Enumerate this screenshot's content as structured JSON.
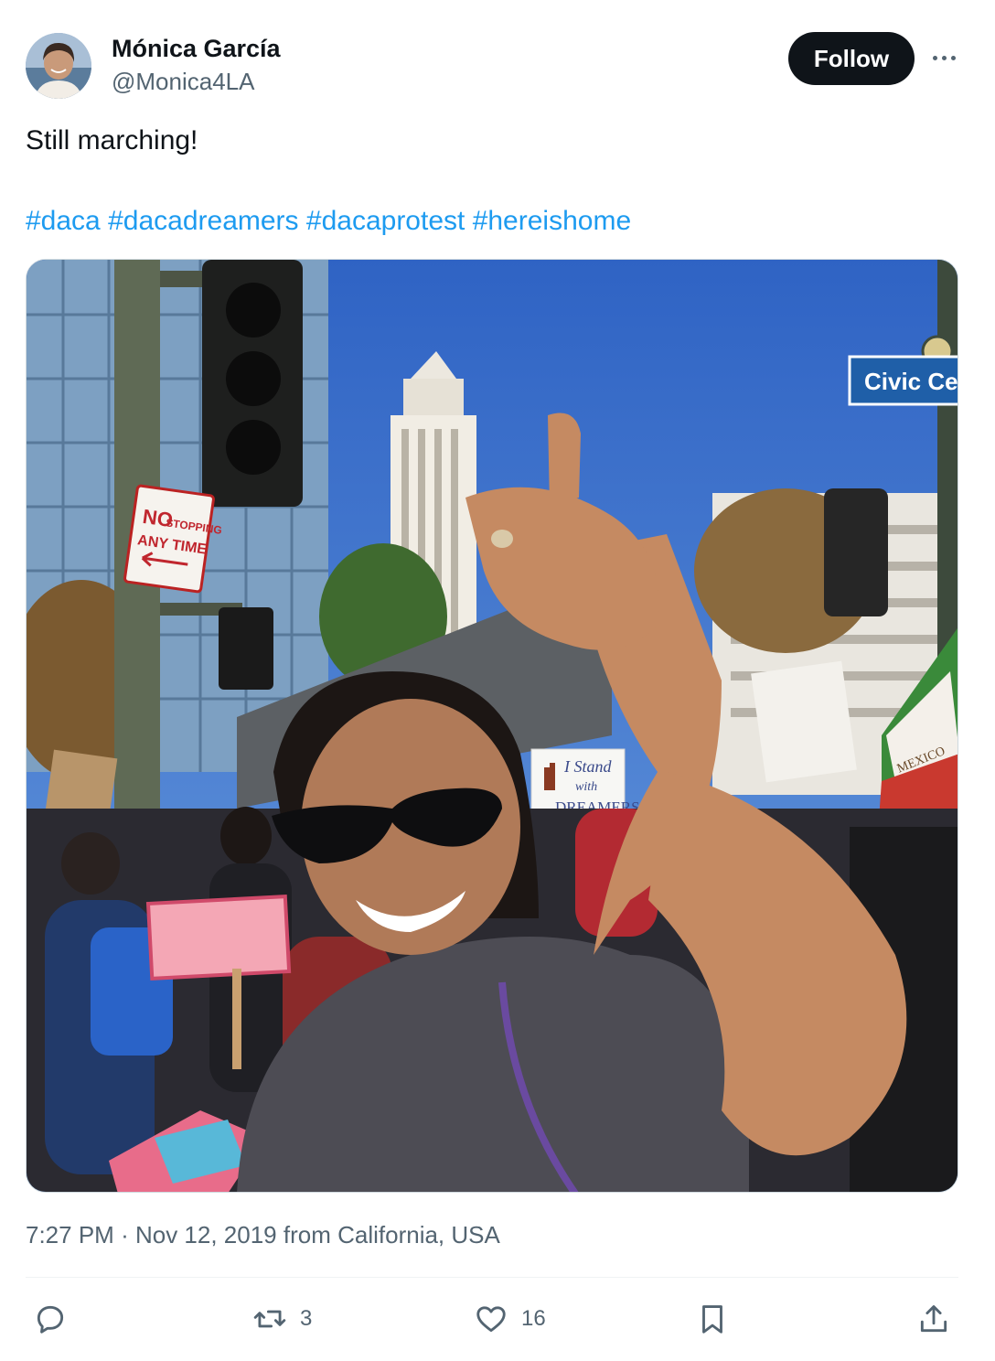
{
  "author": {
    "display_name": "Mónica García",
    "handle": "@Monica4LA"
  },
  "follow_label": "Follow",
  "tweet": {
    "text": "Still marching!",
    "hashtags": [
      "#daca",
      "#dacadreamers",
      "#dacaprotest",
      "#hereishome"
    ]
  },
  "photo": {
    "street_sign": "Civic Ce",
    "no_stopping_sign": [
      "NO",
      "STOPPING",
      "ANY TIME"
    ],
    "protest_sign": [
      "I Stand",
      "with",
      "DREAMERS"
    ],
    "flag_text": "MEXICO"
  },
  "meta": {
    "time": "7:27 PM",
    "separator": "·",
    "date": "Nov 12, 2019",
    "location": "from California, USA"
  },
  "actions": {
    "reply": {
      "icon": "reply-icon",
      "count": ""
    },
    "retweet": {
      "icon": "retweet-icon",
      "count": "3"
    },
    "like": {
      "icon": "heart-icon",
      "count": "16"
    },
    "bookmark": {
      "icon": "bookmark-icon",
      "count": ""
    },
    "share": {
      "icon": "share-icon",
      "count": ""
    }
  },
  "colors": {
    "link": "#1d9bf0",
    "text": "#0f1419",
    "muted": "#536471",
    "button": "#0f1419"
  }
}
